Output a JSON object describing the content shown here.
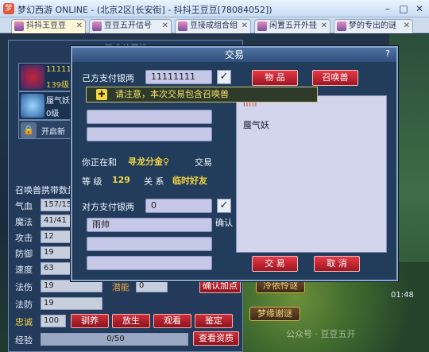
{
  "window": {
    "title": "梦幻西游 ONLINE - (北京2区[长安街] - 抖抖王豆豆[78084052])"
  },
  "tabs": [
    {
      "label": "抖抖王豆豆"
    },
    {
      "label": "豆豆五开估号"
    },
    {
      "label": "豆接成组合组"
    },
    {
      "label": "闲置五开外挂"
    },
    {
      "label": "梦的专出的谜"
    }
  ],
  "pet_panel": {
    "header": "召唤兽属性",
    "slot1": {
      "level_text": "11111",
      "sub": "139级"
    },
    "slot2": {
      "name": "蜃气妖",
      "level": "0级"
    },
    "unlock": "开启新",
    "carry_count": "召唤兽携带数量",
    "stats": [
      {
        "label": "气血",
        "value": "157/157"
      },
      {
        "label": "魔法",
        "value": "41/41"
      },
      {
        "label": "攻击",
        "value": "12"
      },
      {
        "label": "防御",
        "value": "19"
      },
      {
        "label": "速度",
        "value": "63"
      },
      {
        "label": "法伤",
        "value": "19"
      },
      {
        "label": "法防",
        "value": "19"
      }
    ],
    "potential_label": "潜能",
    "potential_value": "0",
    "confirm_add": "确认加点",
    "loyalty_label": "忠诚",
    "loyalty_value": "100",
    "buttons": [
      "驯养",
      "放生",
      "观看",
      "鉴定"
    ],
    "exp_label": "经验",
    "exp_value": "0/50",
    "view_aptitude": "查看资质"
  },
  "trade": {
    "title": "交易",
    "help": "?",
    "my_silver_label": "己方支付银两",
    "my_silver_value": "11111111",
    "tab_items": "物 品",
    "tab_pets": "召唤兽",
    "notice": "请注意，本次交易包含召唤兽",
    "trading_with_prefix": "你正在和",
    "partner_name": "寻龙分金♀",
    "trading_with_suffix": "交易",
    "level_label": "等 级",
    "level_value": "129",
    "relation_label": "关 系",
    "relation_value": "临时好友",
    "their_silver_label": "对方支付银两",
    "their_silver_value": "0",
    "confirm_label": "确认",
    "their_item_1": "雨帅",
    "offered_marker": "IIIII",
    "offered_item": "蜃气妖",
    "trade_button": "交 易",
    "cancel_button": "取 消"
  },
  "scene": {
    "npc_label_1": "冷依怜谜",
    "npc_label_2": "梦缘谢谜",
    "time": "01:48",
    "watermark": "公众号 · 豆豆五开"
  }
}
